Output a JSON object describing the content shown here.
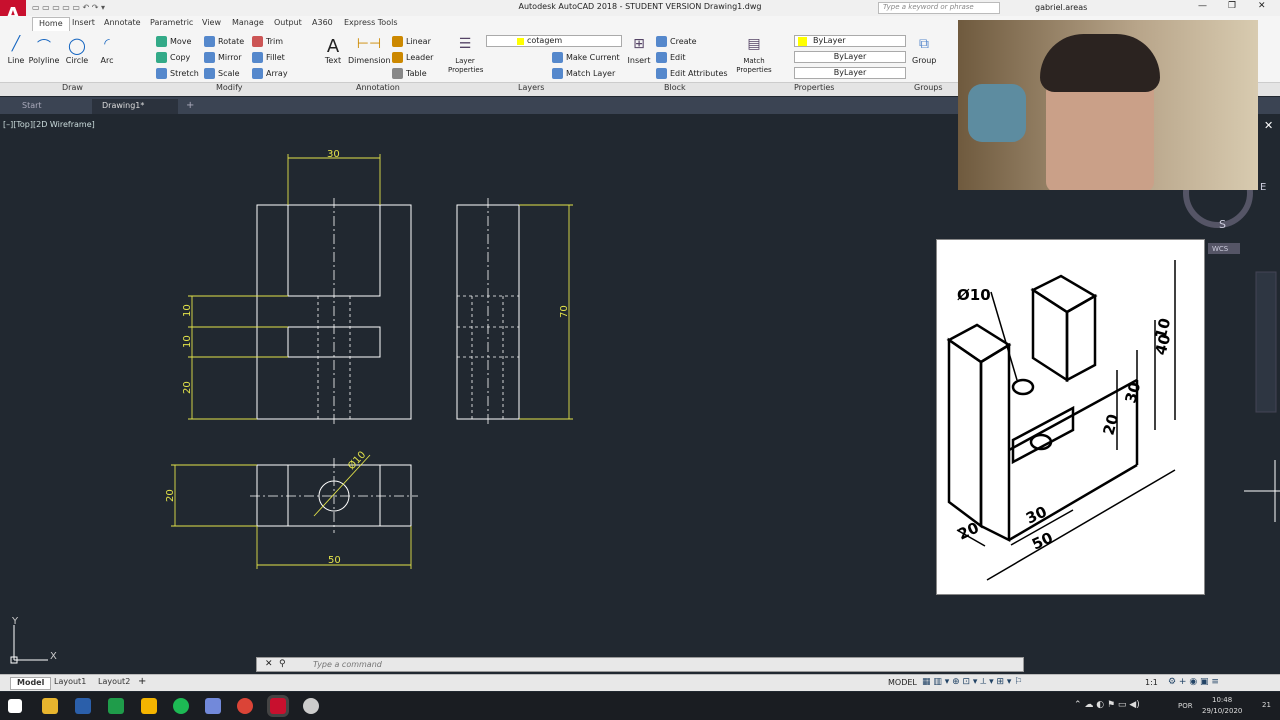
{
  "titlebar": {
    "title": "Autodesk AutoCAD 2018 - STUDENT VERSION    Drawing1.dwg",
    "search_placeholder": "Type a keyword or phrase",
    "user": "gabriel.areas"
  },
  "ribbon": {
    "tabs": [
      "Home",
      "Insert",
      "Annotate",
      "Parametric",
      "View",
      "Manage",
      "Output",
      "A360",
      "Express Tools"
    ],
    "draw": {
      "line": "Line",
      "polyline": "Polyline",
      "circle": "Circle",
      "arc": "Arc",
      "panel": "Draw"
    },
    "modify": {
      "move": "Move",
      "rotate": "Rotate",
      "trim": "Trim",
      "copy": "Copy",
      "mirror": "Mirror",
      "fillet": "Fillet",
      "stretch": "Stretch",
      "scale": "Scale",
      "array": "Array",
      "panel": "Modify"
    },
    "annotation": {
      "text": "Text",
      "dimension": "Dimension",
      "linear": "Linear",
      "leader": "Leader",
      "table": "Table",
      "panel": "Annotation"
    },
    "layers": {
      "layer_properties": "Layer Properties",
      "current_layer": "cotagem",
      "make_current": "Make Current",
      "match_layer": "Match Layer",
      "panel": "Layers"
    },
    "block": {
      "insert": "Insert",
      "create": "Create",
      "edit": "Edit",
      "edit_attributes": "Edit Attributes",
      "panel": "Block"
    },
    "properties": {
      "match": "Match Properties",
      "color": "ByLayer",
      "linetype": "ByLayer",
      "lineweight": "ByLayer",
      "panel": "Properties"
    },
    "groups": {
      "group": "Group",
      "panel": "Groups"
    }
  },
  "filetabs": {
    "start": "Start",
    "drawing": "Drawing1*"
  },
  "viewport": {
    "label": "[–][Top][2D Wireframe]",
    "compass_s": "S",
    "compass_e": "E",
    "wcs": "WCS",
    "ucs_x": "X",
    "ucs_y": "Y"
  },
  "dims": {
    "d30": "30",
    "d10a": "10",
    "d10b": "10",
    "d20": "20",
    "d70": "70",
    "d20b": "20",
    "d50": "50",
    "dia": "Ø10"
  },
  "ref": {
    "dia": "Ø10",
    "d40": "40",
    "d30": "30",
    "d20": "20",
    "d10": "10",
    "d30b": "30",
    "d50": "50",
    "d20b": "20"
  },
  "command": {
    "placeholder": "Type a command"
  },
  "layouts": {
    "model": "Model",
    "layout1": "Layout1",
    "layout2": "Layout2"
  },
  "status": {
    "model": "MODEL",
    "scale": "1:1"
  },
  "taskbar": {
    "lang": "POR",
    "time": "10:48",
    "date": "29/10/2020",
    "notif": "21"
  },
  "colors": {
    "dim": "#e3e34a",
    "line": "#ffffff",
    "bg": "#212830"
  }
}
